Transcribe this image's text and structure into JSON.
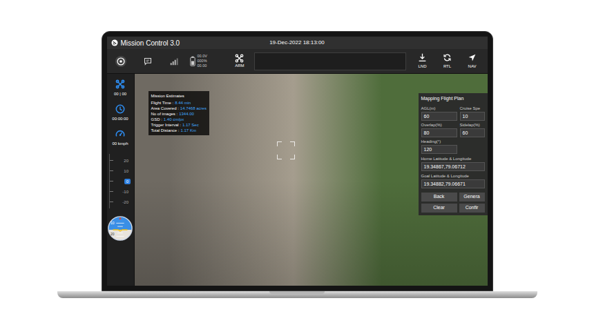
{
  "window": {
    "title": "Mission Control 3.0",
    "datetime": "19-Dec-2022 18:13:00"
  },
  "toolbar": {
    "battery": [
      "00.0V",
      "000%",
      "00.00"
    ],
    "arm": "ARM",
    "actions": [
      {
        "label": "LND"
      },
      {
        "label": "RTL"
      },
      {
        "label": "NAV"
      }
    ]
  },
  "sidebar": {
    "drone": "00 | 00",
    "timer": "00:00:00",
    "speed": "00 kmph",
    "altitude_ticks": [
      {
        "label": "20",
        "selected": false
      },
      {
        "label": "10",
        "selected": false
      },
      {
        "label": "0",
        "selected": true
      },
      {
        "label": "-10",
        "selected": false
      },
      {
        "label": "-20",
        "selected": false
      }
    ],
    "attitude_ticks": [
      "10",
      "20"
    ]
  },
  "mission_estimates": {
    "title": "Mission Estimates",
    "rows": [
      {
        "label": "Flight Time :",
        "value": "8.44 min"
      },
      {
        "label": "Area Covered :",
        "value": "14.7468 acres"
      },
      {
        "label": "No of images :",
        "value": "1344.00"
      },
      {
        "label": "GSD :",
        "value": "1.40 cm/px"
      },
      {
        "label": "Trigger Interval :",
        "value": "1.17 Sec"
      },
      {
        "label": "Total Distance :",
        "value": "1.17 Km"
      }
    ]
  },
  "flight_plan": {
    "title": "Mapping Flight Plan",
    "fields": [
      {
        "label": "AGL(m)",
        "value": "60"
      },
      {
        "label": "Cruise Spe",
        "value": "10"
      },
      {
        "label": "Overlap(%)",
        "value": "80"
      },
      {
        "label": "Sidelap(%)",
        "value": "60"
      },
      {
        "label": "Heading(°)",
        "value": "120"
      }
    ],
    "coordinates": [
      {
        "label": "Home Latitude & Longitude",
        "value": "19.34867,79.06712"
      },
      {
        "label": "Goal Latitude & Longitude",
        "value": "19.34882,79.06671"
      }
    ],
    "buttons": [
      "Back",
      "Genera",
      "Clear",
      "Confir"
    ]
  }
}
